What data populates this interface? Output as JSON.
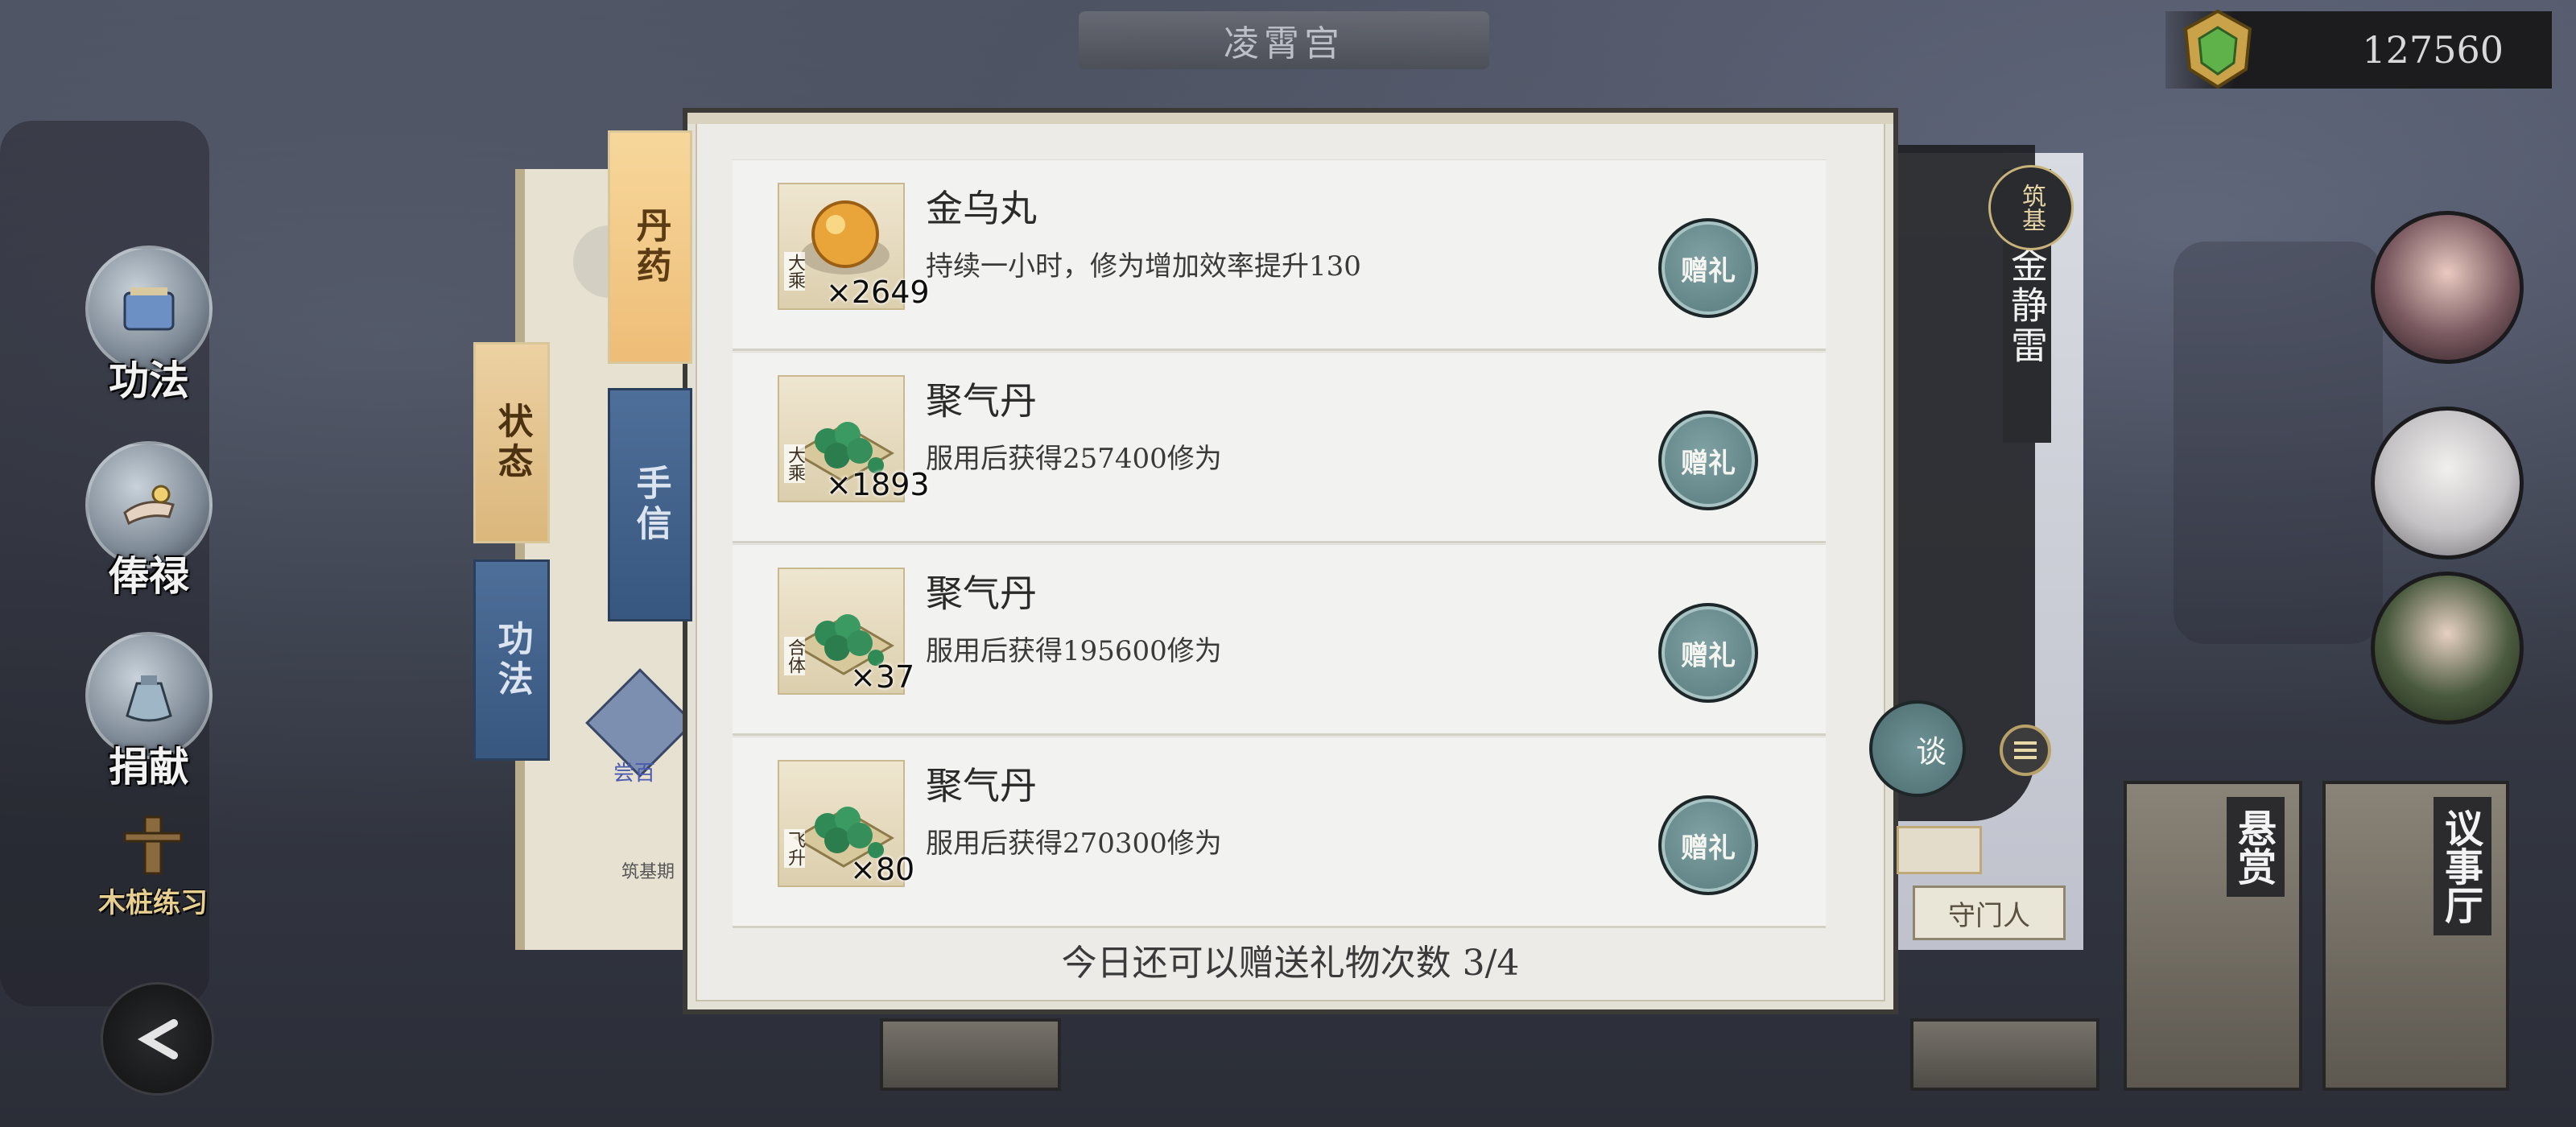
{
  "location_title": "凌霄宫",
  "currency": {
    "amount": "127560",
    "icon": "jade-token-icon"
  },
  "left_menu": [
    {
      "label": "功法",
      "icon": "scroll-book-icon"
    },
    {
      "label": "俸禄",
      "icon": "hand-salary-icon"
    },
    {
      "label": "捐献",
      "icon": "donation-bag-icon"
    }
  ],
  "wood_practice_label": "木桩练习",
  "tabs": {
    "dan": "丹药",
    "shou": "手信",
    "zhuang": "状态",
    "gong": "功法"
  },
  "behind_panel": {
    "item_label": "尝百",
    "footer": "筑基期"
  },
  "items": [
    {
      "name": "金乌丸",
      "desc": "持续一小时，修为增加效率提升130",
      "rank": "大乘",
      "qty": "×2649",
      "icon": "golden-pill-icon",
      "button": "赠礼"
    },
    {
      "name": "聚气丹",
      "desc": "服用后获得257400修为",
      "rank": "大乘",
      "qty": "×1893",
      "icon": "green-pills-icon",
      "button": "赠礼"
    },
    {
      "name": "聚气丹",
      "desc": "服用后获得195600修为",
      "rank": "合体",
      "qty": "×37",
      "icon": "green-pills-icon",
      "button": "赠礼"
    },
    {
      "name": "聚气丹",
      "desc": "服用后获得270300修为",
      "rank": "飞升",
      "qty": "×80",
      "icon": "green-pills-icon",
      "button": "赠礼"
    }
  ],
  "footer_text": "今日还可以赠送礼物次数 3/4",
  "character": {
    "name": "金静雷",
    "rank": "筑基",
    "chat_label": "谈",
    "guard_label": "守门人"
  },
  "bottom_cards": {
    "bounty": "悬赏",
    "council": "议事厅"
  },
  "colors": {
    "gift_button": "#5f8386",
    "tab_active": "#f0c27f",
    "tab_inactive": "#3e5f8a",
    "panel_bg": "#ecebe7"
  }
}
